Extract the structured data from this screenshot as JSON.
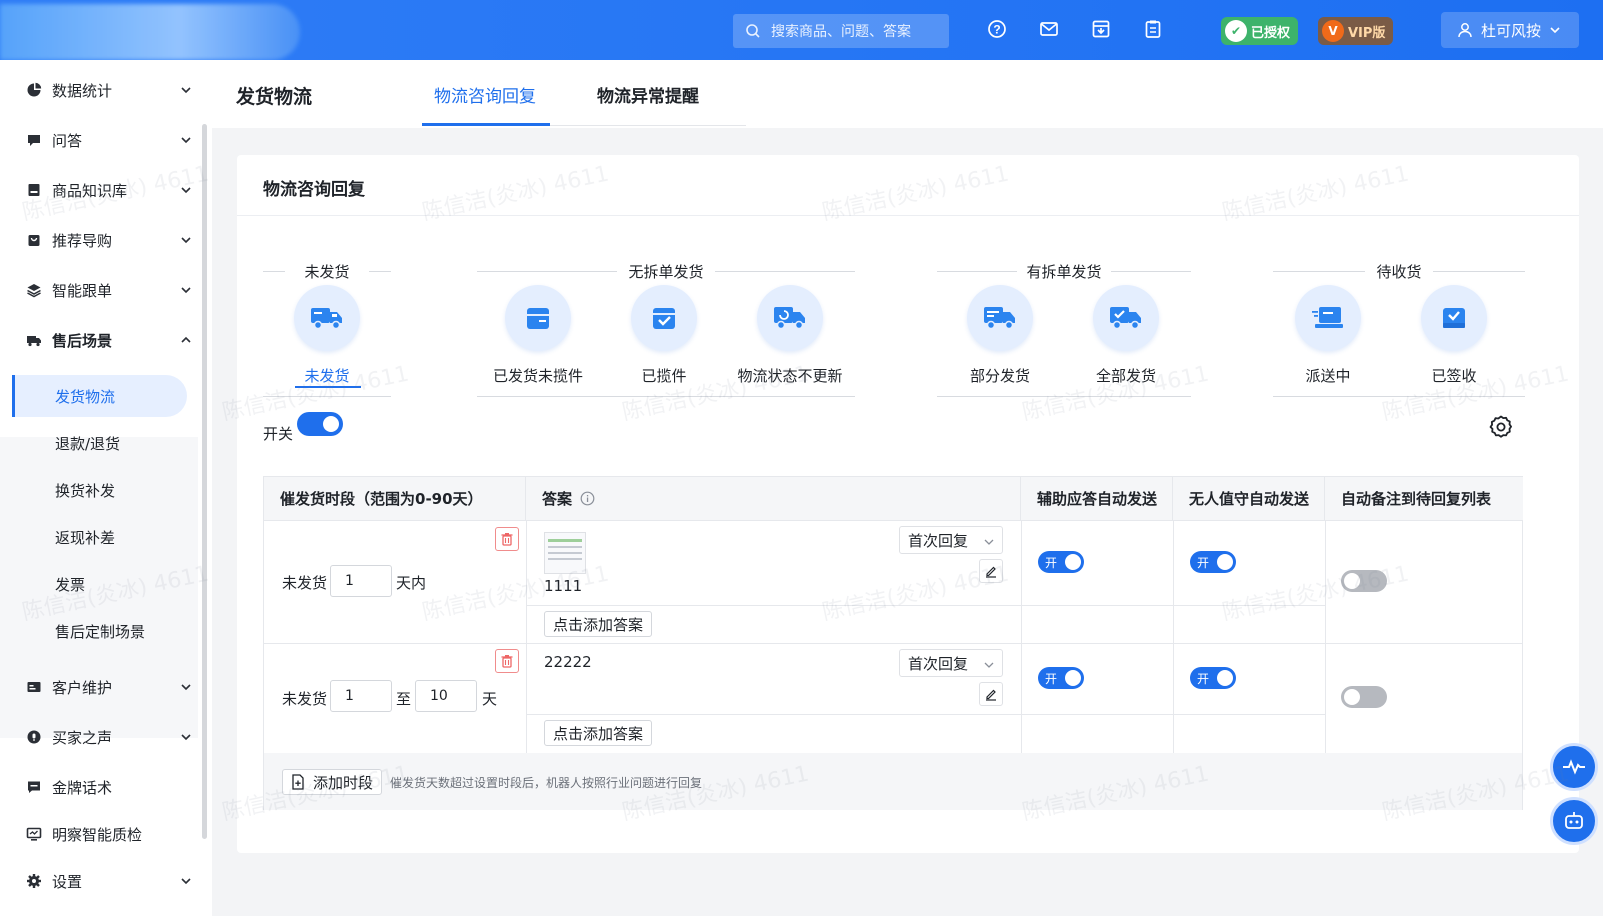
{
  "topbar": {
    "search_placeholder": "搜索商品、问题、答案",
    "authorized_label": "已授权",
    "vip_label": "VIP版",
    "user_name": "杜可风按",
    "colors": {
      "bar": "#1d6ff2",
      "authorized_badge": "#3db36b",
      "vip_badge": "#f06a1a"
    }
  },
  "sidebar": {
    "items": [
      {
        "label": "数据统计",
        "icon": "pie-chart-icon"
      },
      {
        "label": "问答",
        "icon": "chat-icon"
      },
      {
        "label": "商品知识库",
        "icon": "database-icon"
      },
      {
        "label": "推荐导购",
        "icon": "bag-icon"
      },
      {
        "label": "智能跟单",
        "icon": "layers-icon"
      },
      {
        "label": "售后场景",
        "icon": "truck-icon"
      },
      {
        "label": "客户维护",
        "icon": "id-card-icon"
      },
      {
        "label": "买家之声",
        "icon": "voice-icon"
      },
      {
        "label": "金牌话术",
        "icon": "message-icon"
      },
      {
        "label": "明察智能质检",
        "icon": "monitor-icon"
      },
      {
        "label": "设置",
        "icon": "gear-icon"
      }
    ],
    "sub_items": [
      "发货物流",
      "退款/退货",
      "换货补发",
      "返现补差",
      "发票",
      "售后定制场景"
    ]
  },
  "header": {
    "title": "发货物流",
    "tabs": [
      "物流咨询回复",
      "物流异常提醒"
    ]
  },
  "card": {
    "title": "物流咨询回复",
    "groups": [
      "未发货",
      "无拆单发货",
      "有拆单发货",
      "待收货"
    ],
    "stages": [
      "未发货",
      "已发货未揽件",
      "已揽件",
      "物流状态不更新",
      "部分发货",
      "全部发货",
      "派送中",
      "已签收"
    ],
    "switch_label": "开关",
    "switch_on": true
  },
  "table": {
    "headers": [
      "催发货时段（范围为0-90天）",
      "答案",
      "辅助应答自动发送",
      "无人值守自动发送",
      "自动备注到待回复列表"
    ],
    "rows": [
      {
        "prefix": "未发货",
        "from": "1",
        "unit": "天内",
        "answer": "1111",
        "reply_type": "首次回复",
        "add_answer": "点击添加答案",
        "assist_toggle": "开",
        "unattended_toggle": "开",
        "auto_note_on": false
      },
      {
        "prefix": "未发货",
        "from": "1",
        "sep": "至",
        "to": "10",
        "unit": "天",
        "answer": "22222",
        "reply_type": "首次回复",
        "add_answer": "点击添加答案",
        "assist_toggle": "开",
        "unattended_toggle": "开",
        "auto_note_on": false
      }
    ],
    "add_segment": "添加时段",
    "hint": "催发货天数超过设置时段后，机器人按照行业问题进行回复"
  },
  "watermark": "陈信洁(炎冰) 4611"
}
